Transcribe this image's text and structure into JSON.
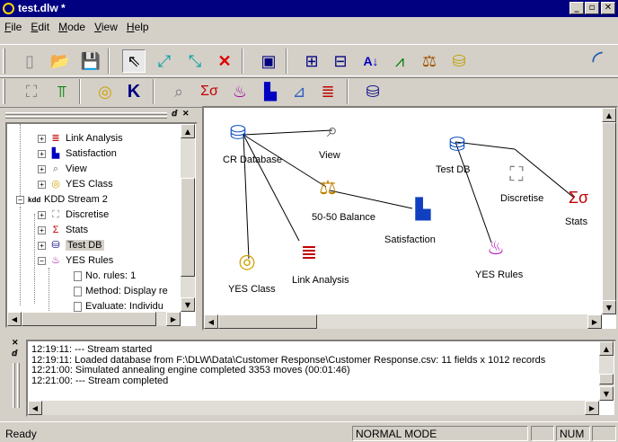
{
  "window": {
    "title": "test.dlw *",
    "min": "_",
    "max": "▫",
    "close": "✕"
  },
  "menu": [
    "File",
    "Edit",
    "Mode",
    "View",
    "Help"
  ],
  "tree": {
    "pin": "ⅆ",
    "close": "✕",
    "items": [
      {
        "label": "Link Analysis",
        "icon": "link-analysis-icon"
      },
      {
        "label": "Satisfaction",
        "icon": "bar-chart-icon"
      },
      {
        "label": "View",
        "icon": "view-icon"
      },
      {
        "label": "YES Class",
        "icon": "yes-class-icon"
      },
      {
        "label": "KDD Stream 2",
        "icon": "kdd-stream-icon"
      },
      {
        "label": "Discretise",
        "icon": "discretise-icon"
      },
      {
        "label": "Stats",
        "icon": "stats-icon"
      },
      {
        "label": "Test DB",
        "icon": "database-icon"
      },
      {
        "label": "YES Rules",
        "icon": "yes-rules-icon"
      },
      {
        "label": "No. rules: 1",
        "icon": "doc-icon"
      },
      {
        "label": "Method: Display re",
        "icon": "doc-icon"
      },
      {
        "label": "Evaluate: Individu",
        "icon": "doc-icon"
      }
    ]
  },
  "canvas": {
    "nodes": [
      {
        "label": "CR Database"
      },
      {
        "label": "View"
      },
      {
        "label": "50-50 Balance"
      },
      {
        "label": "Satisfaction"
      },
      {
        "label": "YES Class"
      },
      {
        "label": "Link Analysis"
      },
      {
        "label": "Test DB"
      },
      {
        "label": "Discretise"
      },
      {
        "label": "Stats"
      },
      {
        "label": "YES Rules"
      }
    ]
  },
  "log": {
    "lines": [
      "12:19:11:  --- Stream started",
      "12:19:11: Loaded database from F:\\DLW\\Data\\Customer Response\\Customer Response.csv: 11 fields x 1012 records",
      "12:21:00: Simulated annealing engine completed 3353 moves (00:01:46)",
      "12:21:00:  --- Stream completed"
    ]
  },
  "status": {
    "left": "Ready",
    "mode": "NORMAL MODE",
    "num": "NUM"
  },
  "colors": {
    "title_bg": "#000080",
    "face": "#d4d0c8",
    "accent": "#0000ff"
  }
}
